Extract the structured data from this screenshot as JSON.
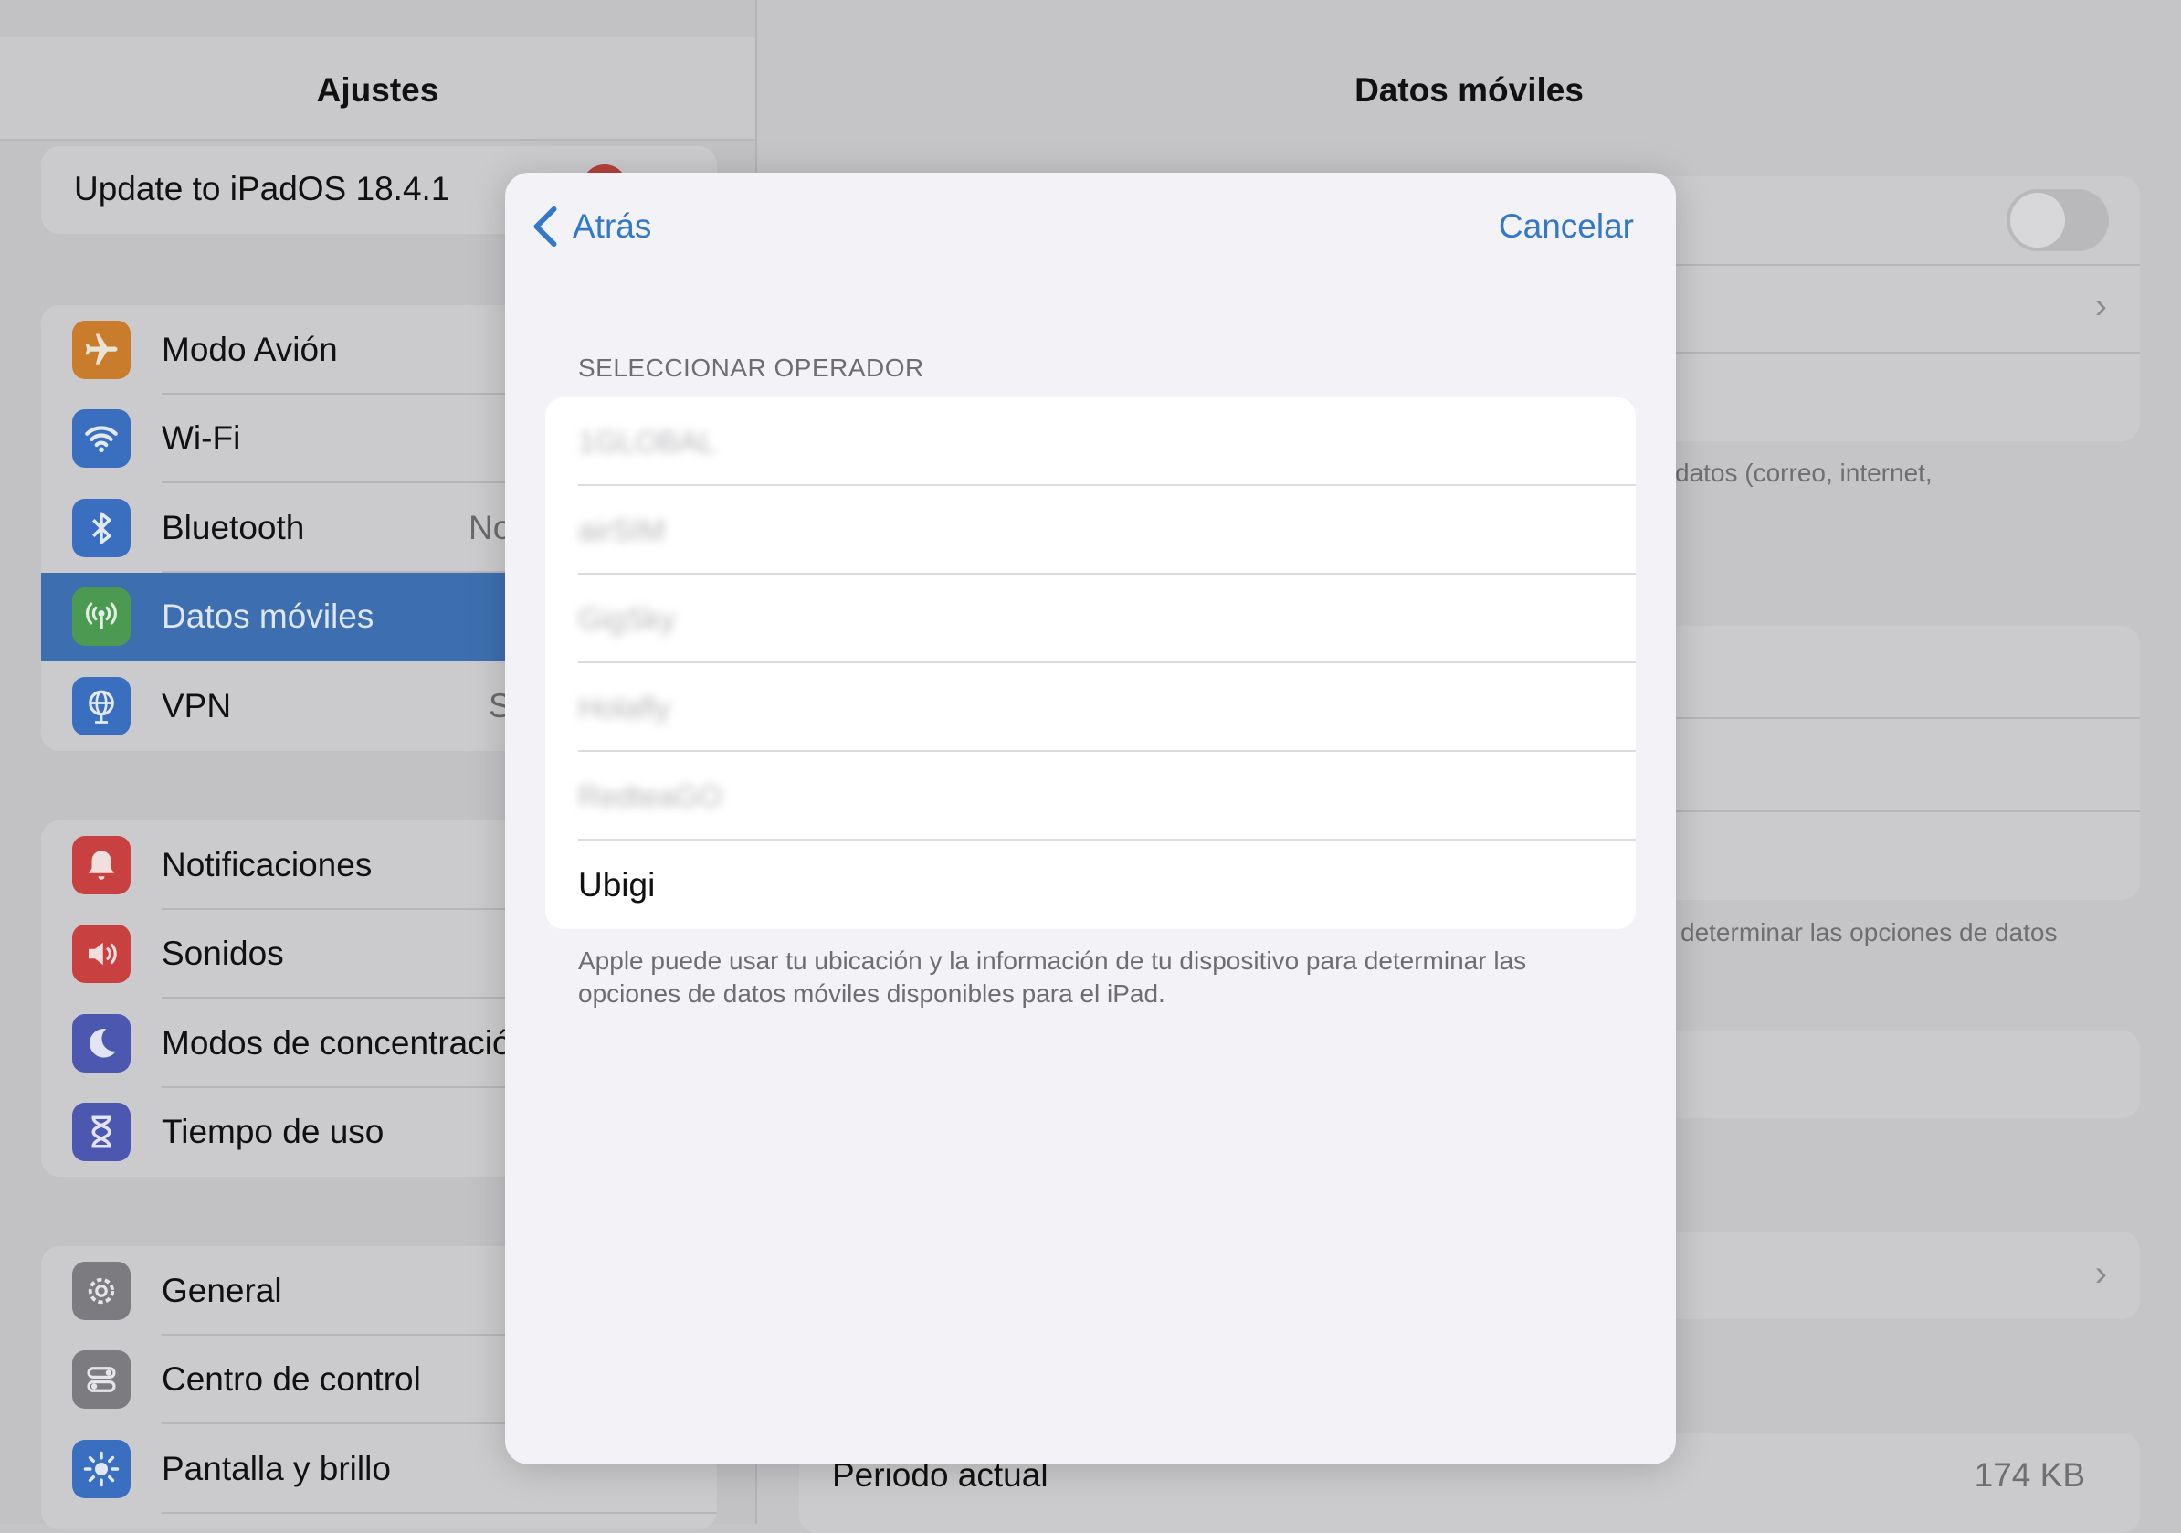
{
  "sidebar": {
    "title": "Ajustes",
    "update_text": "Update to iPadOS 18.4.1",
    "group1": [
      {
        "label": "Modo Avión",
        "value": "",
        "icon": "airplane-icon",
        "color": "#c97d2c"
      },
      {
        "label": "Wi-Fi",
        "value": "",
        "icon": "wifi-icon",
        "color": "#3a6fc0"
      },
      {
        "label": "Bluetooth",
        "value": "No",
        "icon": "bluetooth-icon",
        "color": "#3a6fc0"
      },
      {
        "label": "Datos móviles",
        "value": "",
        "icon": "antenna-icon",
        "color": "#4c9a52",
        "selected": true
      },
      {
        "label": "VPN",
        "value": "S",
        "icon": "globe-icon",
        "color": "#3a6fc0"
      }
    ],
    "group2": [
      {
        "label": "Notificaciones",
        "icon": "bell-icon",
        "color": "#c94040"
      },
      {
        "label": "Sonidos",
        "icon": "speaker-icon",
        "color": "#c94040"
      },
      {
        "label": "Modos de concentración",
        "icon": "moon-icon",
        "color": "#4c57b0"
      },
      {
        "label": "Tiempo de uso",
        "icon": "hourglass-icon",
        "color": "#4c57b0"
      }
    ],
    "group3": [
      {
        "label": "General",
        "icon": "gear-icon",
        "color": "#7b7b80"
      },
      {
        "label": "Centro de control",
        "icon": "switches-icon",
        "color": "#7b7b80"
      },
      {
        "label": "Pantalla y brillo",
        "icon": "sun-icon",
        "color": "#3a6fc0"
      }
    ]
  },
  "detail": {
    "title": "Datos móviles",
    "note1": "datos (correo, internet,",
    "note2": "determinar las opciones de datos",
    "period_label": "Periodo actual",
    "period_value": "174 KB"
  },
  "modal": {
    "back_label": "Atrás",
    "cancel_label": "Cancelar",
    "section_label": "SELECCIONAR OPERADOR",
    "operators": [
      {
        "name": "1GLOBAL",
        "blurred": true
      },
      {
        "name": "airSIM",
        "blurred": true
      },
      {
        "name": "GigSky",
        "blurred": true
      },
      {
        "name": "Holafly",
        "blurred": true
      },
      {
        "name": "RedteaGO",
        "blurred": true
      },
      {
        "name": "Ubigi",
        "blurred": false
      }
    ],
    "footer": "Apple puede usar tu ubicación y la información de tu dispositivo para determinar las opciones de datos móviles disponibles para el iPad.",
    "accent_color": "#3478c8"
  }
}
